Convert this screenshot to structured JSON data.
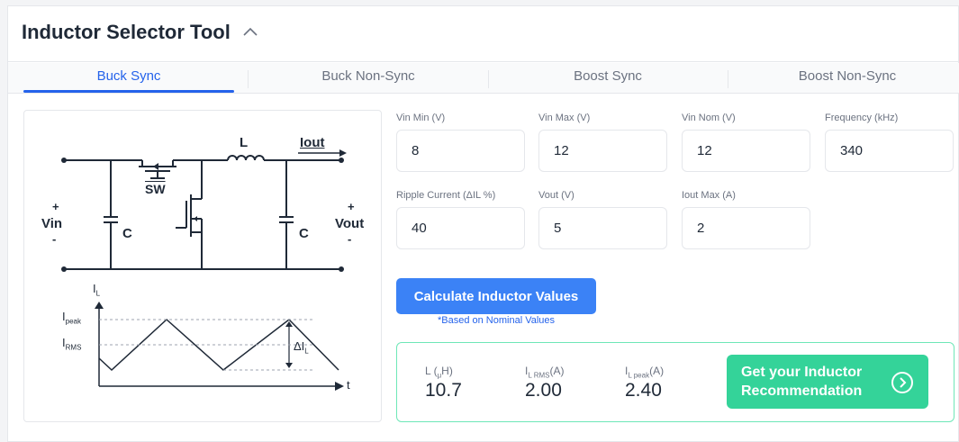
{
  "header": {
    "title": "Inductor Selector Tool"
  },
  "tabs": [
    {
      "label": "Buck Sync",
      "active": true
    },
    {
      "label": "Buck Non-Sync",
      "active": false
    },
    {
      "label": "Boost Sync",
      "active": false
    },
    {
      "label": "Boost Non-Sync",
      "active": false
    }
  ],
  "diagram": {
    "inductor_label": "L",
    "iout_label": "Iout",
    "switch_label": "SW",
    "vin_label": "Vin",
    "vout_label": "Vout",
    "cap_label": "C",
    "plus": "+",
    "minus": "-",
    "waveform": {
      "y_axis": "I",
      "y_axis_sub": "L",
      "peak_label": "I",
      "peak_sub": "peak",
      "rms_label": "I",
      "rms_sub": "RMS",
      "delta_label": "ΔI",
      "delta_sub": "L",
      "x_axis": "t"
    }
  },
  "inputs": {
    "vin_min": {
      "label": "Vin Min (V)",
      "value": "8"
    },
    "vin_max": {
      "label": "Vin Max (V)",
      "value": "12"
    },
    "vin_nom": {
      "label": "Vin Nom (V)",
      "value": "12"
    },
    "frequency": {
      "label": "Frequency (kHz)",
      "value": "340"
    },
    "ripple": {
      "label": "Ripple Current (ΔIL %)",
      "value": "40"
    },
    "vout": {
      "label": "Vout (V)",
      "value": "5"
    },
    "iout_max": {
      "label": "Iout Max (A)",
      "value": "2"
    }
  },
  "calculate": {
    "label": "Calculate Inductor Values",
    "note": "*Based on Nominal Values"
  },
  "results": {
    "inductance": {
      "label": "L (",
      "label_sub": "μ",
      "label_end": "H)",
      "value": "10.7"
    },
    "irms": {
      "label": "I",
      "label_sub": "L RMS",
      "label_end": "(A)",
      "value": "2.00"
    },
    "ipeak": {
      "label": "I",
      "label_sub": "L peak",
      "label_end": "(A)",
      "value": "2.40"
    },
    "recommendation": "Get your Inductor Recommendation"
  },
  "colors": {
    "accent": "#2563eb",
    "button": "#3b82f6",
    "success": "#34d399",
    "success_border": "#6ee7b7"
  },
  "icons": {
    "collapse": "chevron-up-icon",
    "recommendation": "chevron-right-circle-icon"
  }
}
